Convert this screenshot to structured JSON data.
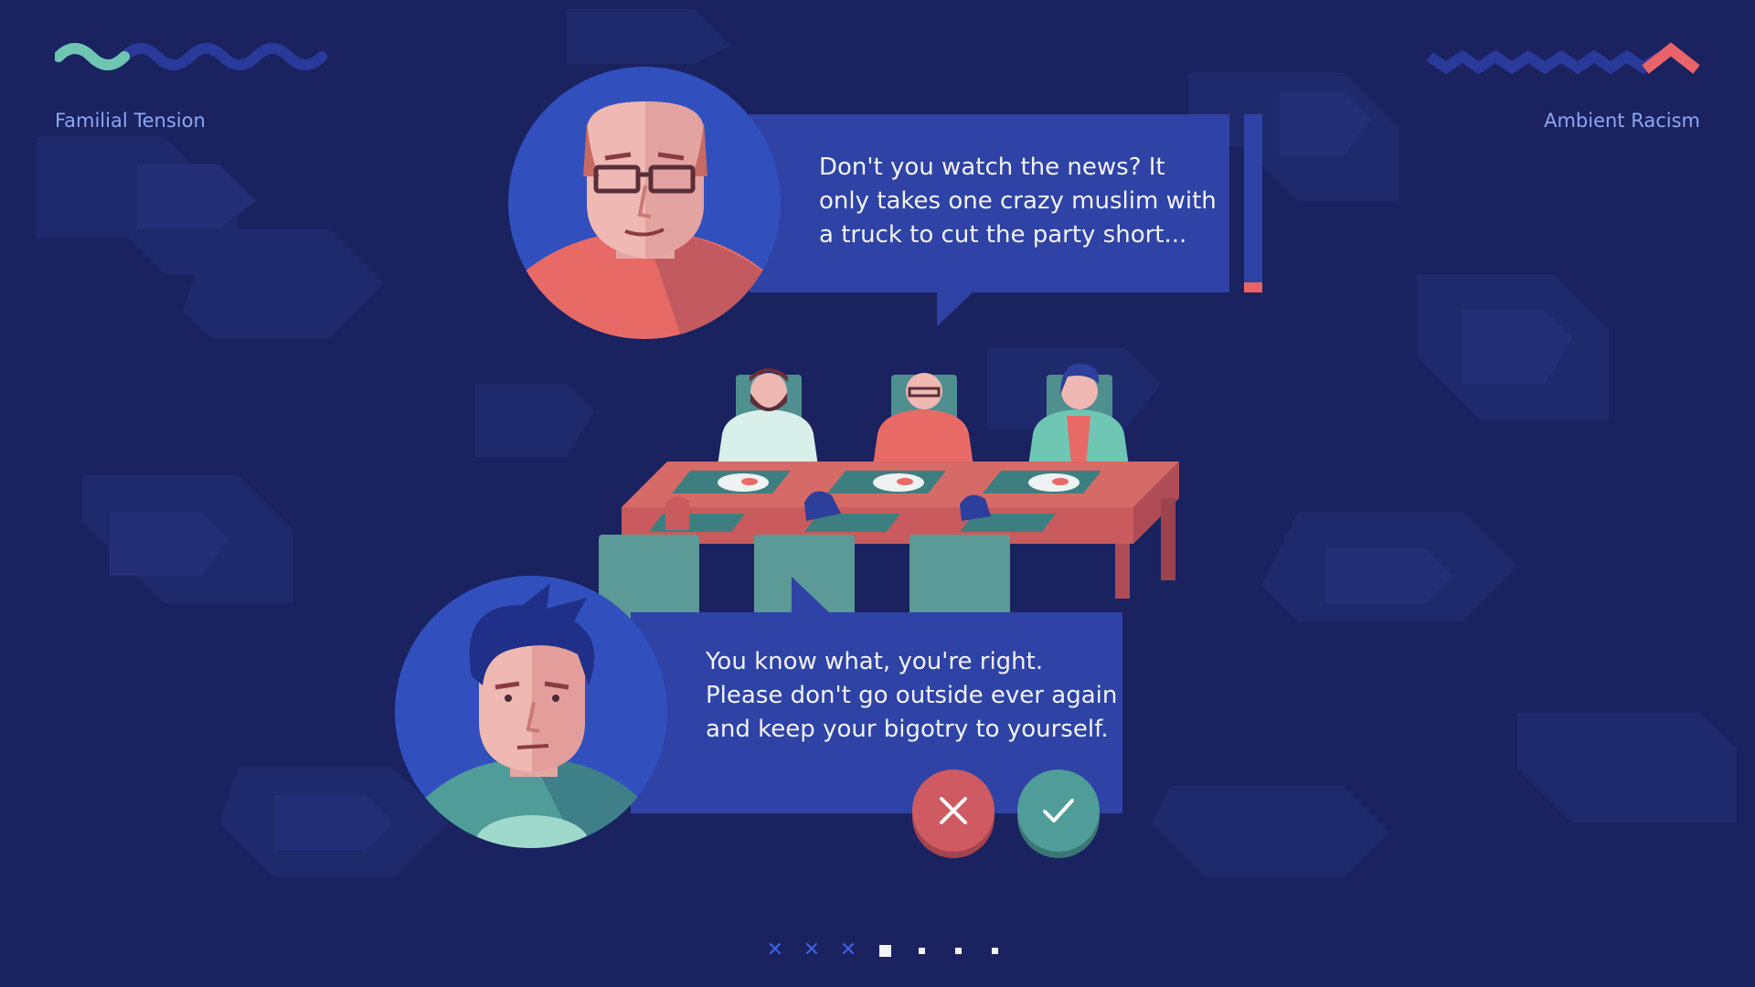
{
  "meters": {
    "left": {
      "label": "Familial Tension",
      "color": "#6fc7b3",
      "level": 0.28
    },
    "right": {
      "label": "Ambient Racism",
      "color": "#e8636a",
      "level": 0.12
    }
  },
  "dialogue": {
    "npc": {
      "lines": [
        "Don't you watch the news? It",
        "only takes one crazy muslim with",
        "a truck to cut the party short..."
      ],
      "timer_remaining": 0.06,
      "timer_color": "#e86466"
    },
    "player": {
      "lines": [
        "You know what, you're right.",
        "Please don't go outside ever again",
        "and keep your bigotry to yourself."
      ]
    },
    "actions": {
      "reject_icon": "close-icon",
      "accept_icon": "check-icon"
    }
  },
  "progress": {
    "steps": [
      "done",
      "done",
      "done",
      "current",
      "pending",
      "pending",
      "pending"
    ],
    "done_color": "#3e62e0"
  },
  "colors": {
    "background": "#1a2260",
    "bubble": "#2e43a5",
    "text": "#f3f3f8"
  }
}
